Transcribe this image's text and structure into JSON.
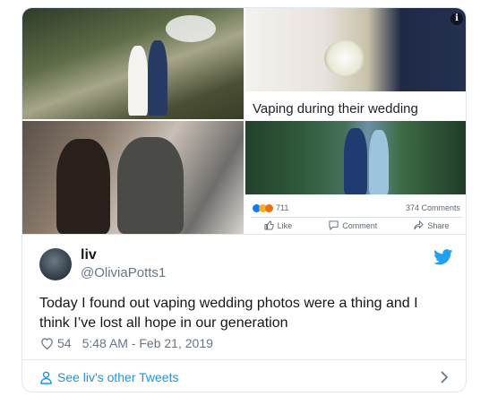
{
  "media": {
    "caption": "Vaping during their wedding",
    "info_icon": "i",
    "reaction_count": "711",
    "comment_count": "374 Comments",
    "actions": {
      "like": "Like",
      "comment": "Comment",
      "share": "Share"
    }
  },
  "tweet": {
    "author_name": "liv",
    "author_handle": "@OliviaPotts1",
    "text": "Today I found out vaping wedding photos were a thing and I think I’ve lost all hope in our generation",
    "likes": "54",
    "timestamp": "5:48 AM - Feb 21, 2019"
  },
  "footer": {
    "link_label": "See liv's other Tweets"
  },
  "colors": {
    "twitter_blue": "#1da1f2",
    "link_blue": "#1b95e0",
    "secondary_text": "#657786"
  }
}
